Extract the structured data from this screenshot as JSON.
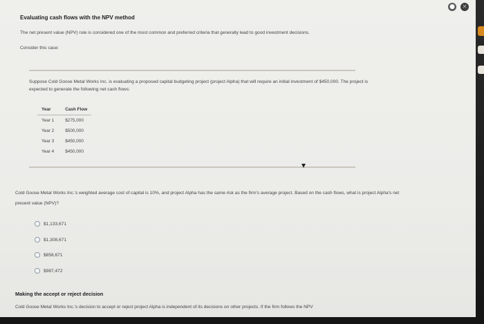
{
  "page": {
    "title": "Evaluating cash flows with the NPV method",
    "intro": "The net present value (NPV) rule is considered one of the most common and preferred criteria that generally lead to good investment decisions.",
    "consider": "Consider this case:"
  },
  "case": {
    "text": "Suppose Cold Goose Metal Works Inc. is evaluating a proposed capital budgeting project (project Alpha) that will require an initial investment of $450,000. The project is expected to generate the following net cash flows:",
    "table": {
      "headers": [
        "Year",
        "Cash Flow"
      ],
      "rows": [
        {
          "year": "Year 1",
          "cash_flow": "$275,000"
        },
        {
          "year": "Year 2",
          "cash_flow": "$500,000"
        },
        {
          "year": "Year 3",
          "cash_flow": "$450,000"
        },
        {
          "year": "Year 4",
          "cash_flow": "$450,000"
        }
      ]
    }
  },
  "question": {
    "text": "Cold Goose Metal Works Inc.'s weighted average cost of capital is 10%, and project Alpha has the same risk as the firm's average project. Based on the cash flows, what is project Alpha's net present value (NPV)?",
    "options": [
      "$1,133,671",
      "$1,308,671",
      "$858,671",
      "$987,472"
    ]
  },
  "section2": {
    "heading": "Making the accept or reject decision",
    "text": "Cold Goose Metal Works Inc.'s decision to accept or reject project Alpha is independent of its decisions on other projects. If the firm follows the NPV"
  },
  "colors": {
    "divider": "#c9c6bd",
    "side_tab_orange": "#d98a1e",
    "window_close": "#5a5a5a"
  }
}
